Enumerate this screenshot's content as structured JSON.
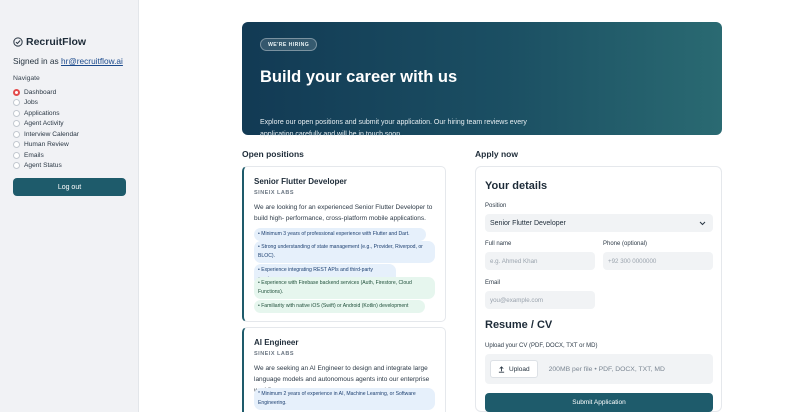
{
  "sidebar": {
    "brand": "RecruitFlow",
    "signed_in_prefix": "Signed in as ",
    "signed_in_email": "hr@recruitflow.ai",
    "nav_title": "Navigate",
    "items": [
      {
        "label": "Dashboard",
        "selected": true
      },
      {
        "label": "Jobs",
        "selected": false
      },
      {
        "label": "Applications",
        "selected": false
      },
      {
        "label": "Agent Activity",
        "selected": false
      },
      {
        "label": "Interview Calendar",
        "selected": false
      },
      {
        "label": "Human Review",
        "selected": false
      },
      {
        "label": "Emails",
        "selected": false
      },
      {
        "label": "Agent Status",
        "selected": false
      }
    ],
    "logout_label": "Log out"
  },
  "hero": {
    "badge": "WE'RE HIRING",
    "title": "Build your career with us",
    "subtitle": "Explore our open positions and submit your application. Our hiring team reviews every application carefully and will be in touch soon."
  },
  "open_positions": {
    "title": "Open positions",
    "jobs": [
      {
        "title": "Senior Flutter Developer",
        "company": "SINEIX LABS",
        "description": "We are looking for an experienced Senior Flutter Developer to build high- performance, cross-platform mobile applications.",
        "requirements": [
          "• Minimum 3 years of professional experience with Flutter and Dart.",
          "• Strong understanding of state management (e.g., Provider, Riverpod, or BLOC).",
          "• Experience integrating REST APIs and third-party services",
          "• Experience with Firebase backend services (Auth, Firestore, Cloud Functions).",
          "• Familiarity with native iOS (Swift) or Android (Kotlin) development"
        ]
      },
      {
        "title": "AI Engineer",
        "company": "SINEIX LABS",
        "description": "We are seeking an AI Engineer to design and integrate large language models and autonomous agents into our enterprise workflows.",
        "requirements": [
          "* Minimum 2 years of experience in AI, Machine Learning, or Software Engineering."
        ]
      }
    ]
  },
  "apply": {
    "title": "Apply now",
    "details_heading": "Your details",
    "position_label": "Position",
    "position_value": "Senior Flutter Developer",
    "full_name_label": "Full name",
    "full_name_placeholder": "e.g. Ahmed Khan",
    "phone_label": "Phone (optional)",
    "phone_placeholder": "+92 300 0000000",
    "email_label": "Email",
    "email_placeholder": "you@example.com",
    "resume_heading": "Resume / CV",
    "upload_label": "Upload your CV (PDF, DOCX, TXT or MD)",
    "upload_button": "Upload",
    "upload_hint": "200MB per file • PDF, DOCX, TXT, MD",
    "submit_label": "Submit Application"
  },
  "colors": {
    "accent": "#1e5b6b",
    "hero_start": "#123a54",
    "hero_end": "#2a6a72",
    "radio_selected": "#e34b4b"
  },
  "icons": [
    "clipboard-check-icon",
    "chevron-down-icon",
    "upload-icon"
  ]
}
